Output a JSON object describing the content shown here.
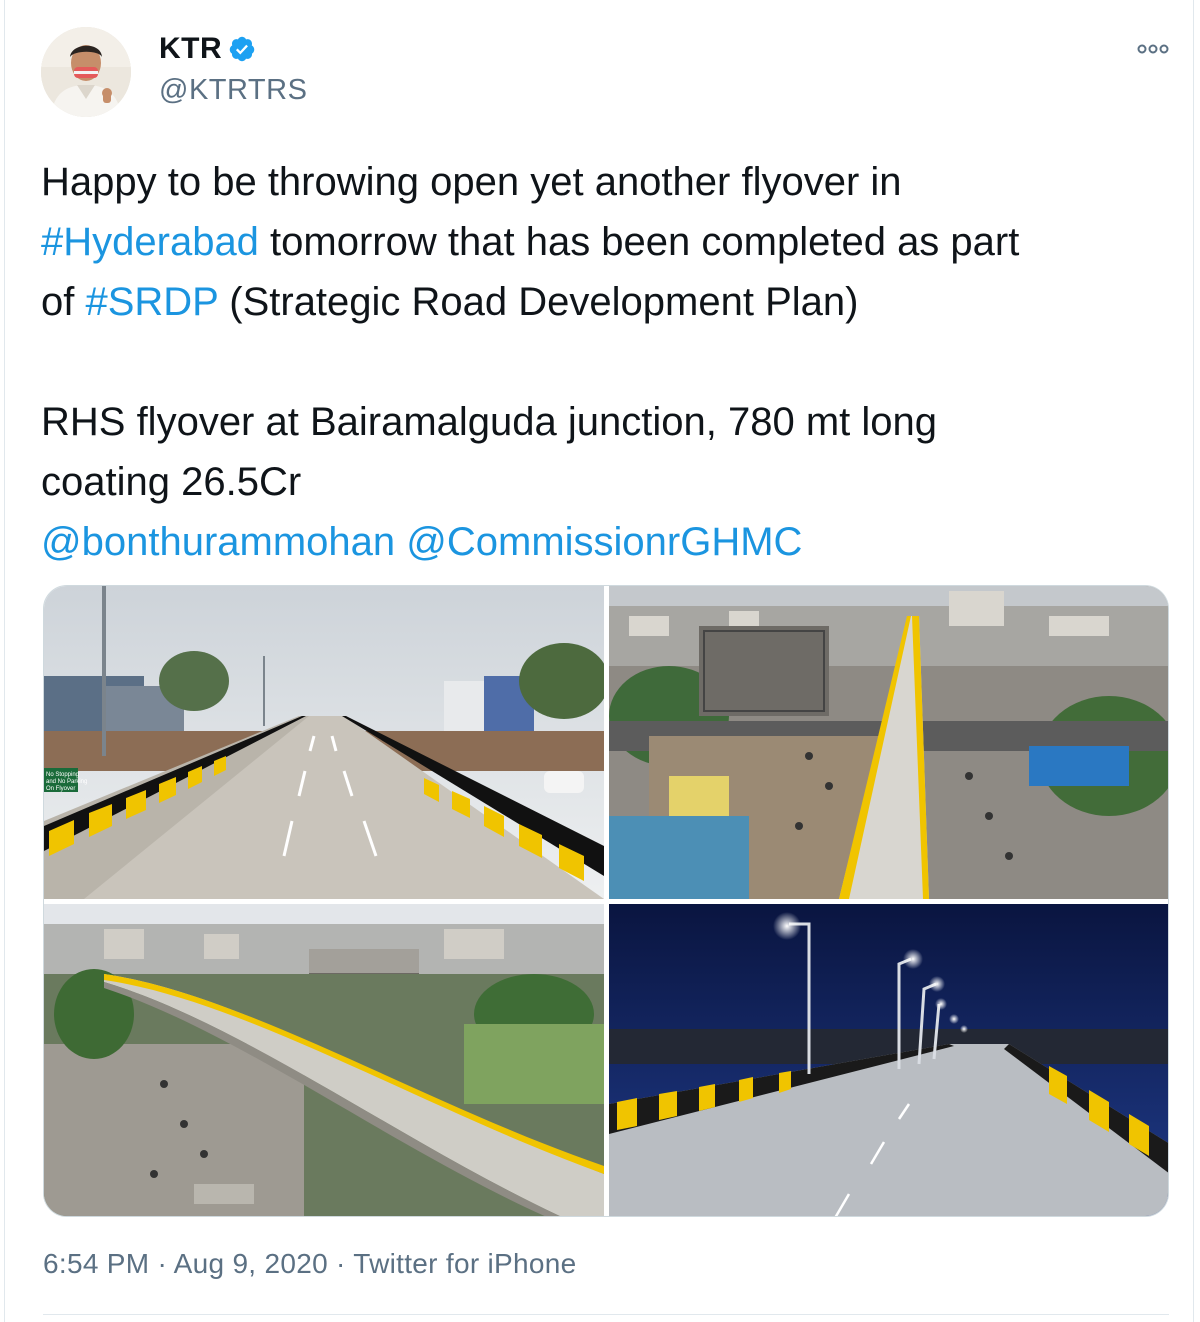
{
  "user": {
    "display_name": "KTR",
    "handle": "@KTRTRS",
    "verified": true,
    "verified_icon": "verified-badge-icon",
    "accent_color": "#1da1f2"
  },
  "tweet": {
    "line1": "Happy to be throwing open yet another flyover in",
    "hashtag_hyderabad": "#Hyderabad",
    "line2_rest": " tomorrow that has been completed as part",
    "line3_prefix": "of ",
    "hashtag_srdp": "#SRDP",
    "line3_rest": " (Strategic Road Development Plan)",
    "line4": "RHS flyover at Bairamalguda junction, 780 mt long",
    "line5": "coating 26.5Cr",
    "mention1": "@bonthurammohan",
    "mention2": "@CommissionrGHMC",
    "link_color": "#1b95e0"
  },
  "media": {
    "sign_text_1": "No Stopping",
    "sign_text_2": "and No Parking",
    "sign_text_3": "On Flyover"
  },
  "footer": {
    "time": "6:54 PM",
    "separator": " · ",
    "date": "Aug 9, 2020",
    "source": "Twitter for iPhone"
  }
}
